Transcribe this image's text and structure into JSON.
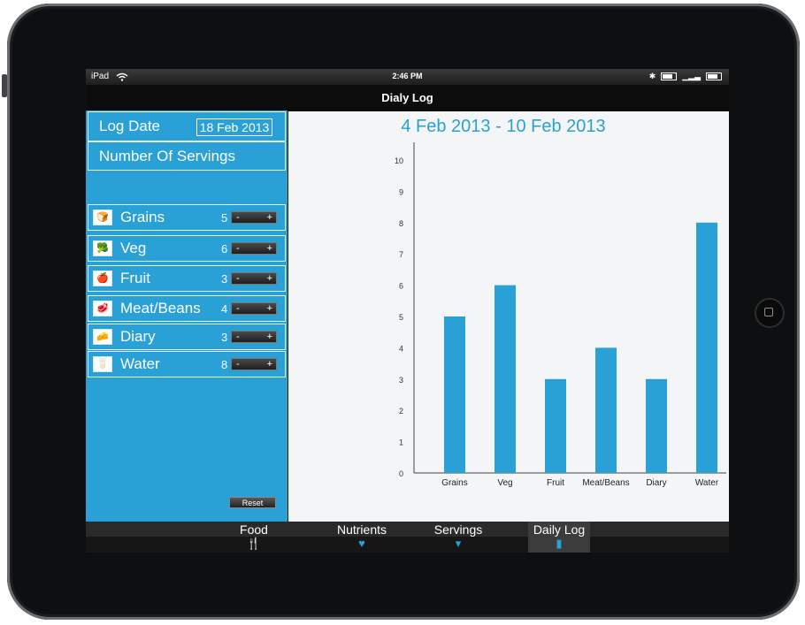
{
  "status": {
    "device": "iPad",
    "time": "2:46 PM"
  },
  "title": "Dialy Log",
  "sidebar": {
    "log_date_label": "Log Date",
    "log_date_value": "18 Feb 2013",
    "servings_header": "Number Of Servings",
    "foods": [
      {
        "name": "Grains",
        "count": "5",
        "icon": "bread-icon"
      },
      {
        "name": "Veg",
        "count": "6",
        "icon": "vegetables-icon"
      },
      {
        "name": "Fruit",
        "count": "3",
        "icon": "fruit-icon"
      },
      {
        "name": "Meat/Beans",
        "count": "4",
        "icon": "meat-icon"
      },
      {
        "name": "Diary",
        "count": "3",
        "icon": "dairy-icon"
      },
      {
        "name": "Water",
        "count": "8",
        "icon": "water-glass-icon"
      }
    ],
    "minus": "-",
    "plus": "+",
    "reset_label": "Reset"
  },
  "range_title": "4 Feb 2013 - 10 Feb 2013",
  "chart_data": {
    "type": "bar",
    "categories": [
      "Grains",
      "Veg",
      "Fruit",
      "Meat/Beans",
      "Diary",
      "Water"
    ],
    "values": [
      5,
      6,
      3,
      4,
      3,
      8
    ],
    "ylim": [
      0,
      10
    ],
    "yticks": [
      0,
      1,
      2,
      3,
      4,
      5,
      6,
      7,
      8,
      9,
      10
    ],
    "bar_color": "#29a1d6",
    "grid": false
  },
  "tabs": [
    {
      "label": "Food",
      "icon": "fork-plate-icon"
    },
    {
      "label": "Nutrients",
      "icon": "heart-icon"
    },
    {
      "label": "Servings",
      "icon": "glass-icon"
    },
    {
      "label": "Daily Log",
      "icon": "bar-chart-icon",
      "active": true
    }
  ],
  "colors": {
    "accent": "#29a1d6"
  }
}
